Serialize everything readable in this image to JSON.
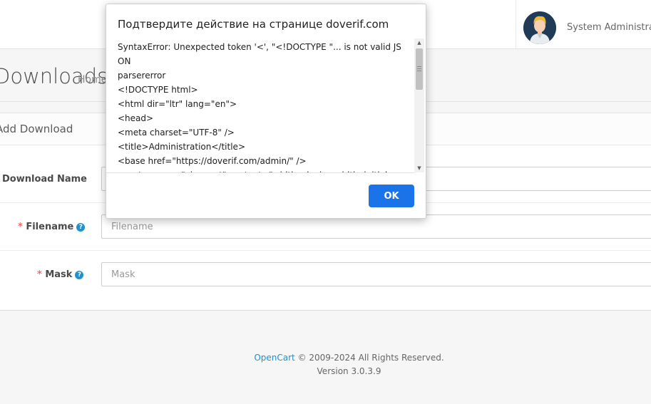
{
  "header": {
    "user_name": "System Administrator"
  },
  "page": {
    "title": "Downloads",
    "breadcrumb_home": "Home"
  },
  "panel": {
    "title": "Add Download",
    "fields": {
      "download_name": {
        "label": "Download Name",
        "value": ""
      },
      "filename": {
        "required": "*",
        "label": "Filename",
        "help": "?",
        "placeholder": "Filename"
      },
      "mask": {
        "required": "*",
        "label": "Mask",
        "help": "?",
        "placeholder": "Mask"
      }
    }
  },
  "footer": {
    "brand": "OpenCart",
    "copyright": " © 2009-2024 All Rights Reserved.",
    "version": "Version 3.0.3.9"
  },
  "dialog": {
    "title": "Подтвердите действие на странице doverif.com",
    "message": "SyntaxError: Unexpected token '<', \"<!DOCTYPE \"... is not valid JSON\nparsererror\n<!DOCTYPE html>\n<html dir=\"ltr\" lang=\"en\">\n<head>\n<meta charset=\"UTF-8\" />\n<title>Administration</title>\n<base href=\"https://doverif.com/admin/\" />\n<meta name=\"viewport\" content=\"width=device-width, initial-scale=1.0, user-scalable=no, minimum-scale=1.0, maximum-",
    "ok_label": "OK"
  },
  "colors": {
    "accent": "#1e91cf",
    "ok_button": "#1a73e8",
    "required": "#f56b6b"
  },
  "icons": {
    "help": "question-circle-icon",
    "scroll_up": "arrow-up-icon",
    "scroll_down": "arrow-down-icon"
  }
}
